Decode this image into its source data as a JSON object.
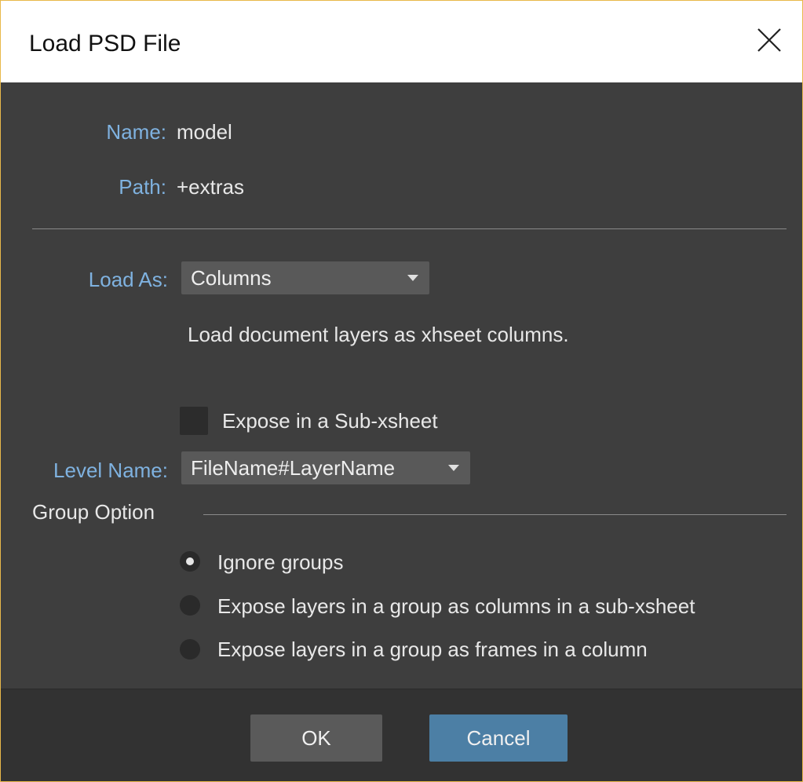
{
  "dialog": {
    "title": "Load PSD File",
    "close_icon": "close-icon"
  },
  "fields": {
    "name_label": "Name:",
    "name_value": "model",
    "path_label": "Path:",
    "path_value": "+extras"
  },
  "load_as": {
    "label": "Load As:",
    "selected": "Columns",
    "description": "Load document layers as xhseet columns."
  },
  "expose_subxsheet": {
    "label": "Expose in a Sub-xsheet",
    "checked": false
  },
  "level_name": {
    "label": "Level Name:",
    "selected": "FileName#LayerName"
  },
  "group_option": {
    "title": "Group Option",
    "options": [
      {
        "label": "Ignore groups",
        "checked": true
      },
      {
        "label": "Expose layers in a group as columns in a sub-xsheet",
        "checked": false
      },
      {
        "label": "Expose layers in a group as frames in a column",
        "checked": false
      }
    ]
  },
  "buttons": {
    "ok": "OK",
    "cancel": "Cancel"
  },
  "colors": {
    "label_blue": "#7fb2e0",
    "cancel_blue": "#4c7fa5",
    "window_border": "#e8b84a"
  }
}
